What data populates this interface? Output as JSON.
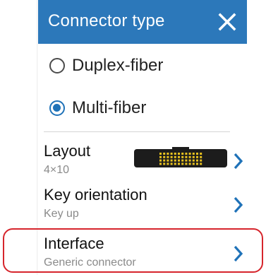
{
  "header": {
    "title": "Connector type",
    "close_icon": "close-icon"
  },
  "options": [
    {
      "label": "Duplex-fiber",
      "selected": false
    },
    {
      "label": "Multi-fiber",
      "selected": true
    }
  ],
  "menu": {
    "layout": {
      "title": "Layout",
      "value": "4×10"
    },
    "key_orientation": {
      "title": "Key orientation",
      "value": "Key up"
    },
    "interface": {
      "title": "Interface",
      "value": "Generic connector"
    }
  },
  "colors": {
    "header_bg": "#2c78ba",
    "accent": "#1f72b8",
    "highlight": "#d6252c"
  },
  "icons": {
    "radio_unselected": "radio-unselected-icon",
    "radio_selected": "radio-selected-icon",
    "chevron": "chevron-right-icon",
    "connector_layout": "mpo-connector-icon"
  }
}
